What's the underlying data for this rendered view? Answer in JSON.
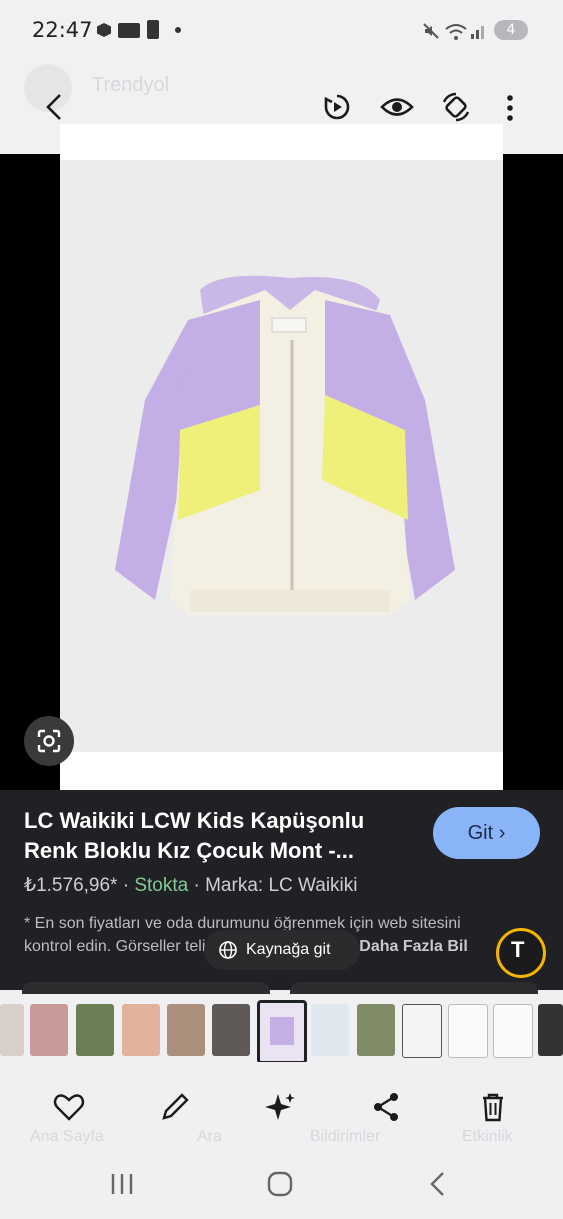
{
  "status_bar": {
    "time": "22:47",
    "battery_badge": "4"
  },
  "top_bar": {
    "ghost_title": "Trendyol",
    "icons": [
      "back-icon",
      "replay-icon",
      "eye-icon",
      "rotate-icon",
      "more-vert-icon"
    ]
  },
  "product": {
    "title": "LC Waikiki LCW Kids Kapüşonlu Renk Bloklu Kız Çocuk Mont -...",
    "price": "₺1.576,96*",
    "stock": "Stokta",
    "brand": "Marka: LC Waikiki",
    "git_label": "Git",
    "note": "* En son fiyatları ve oda durumunu öğrenmek için web sitesini kontrol edin. Görseller telif hakkına tabi olabilir.",
    "more_label": "Daha Fazla Bil",
    "source_label": "Kaynağa git"
  },
  "bottom_bar": {
    "ghost_labels": [
      "Ana Sayfa",
      "Ara",
      "Bildirimler",
      "Etkinlik"
    ],
    "icons": [
      "heart-icon",
      "edit-icon",
      "sparkle-icon",
      "share-icon",
      "trash-icon"
    ]
  },
  "colors": {
    "accent": "#8ab4f8",
    "stock": "#81c995",
    "panel": "#202124"
  }
}
